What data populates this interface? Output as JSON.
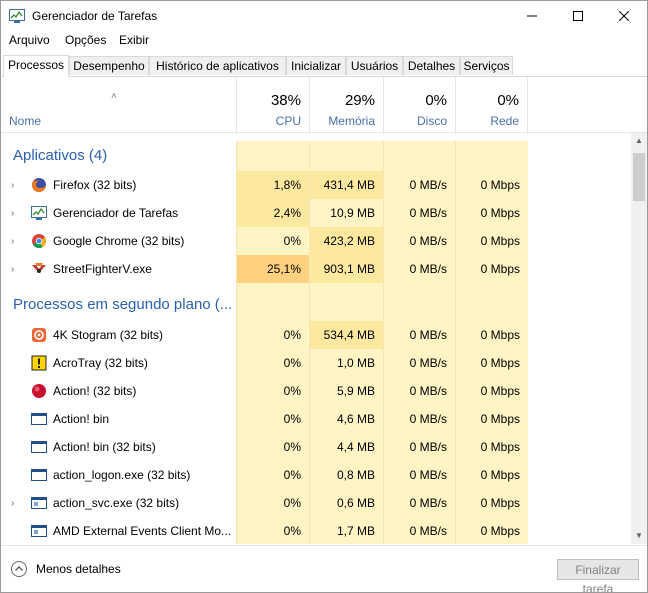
{
  "window": {
    "title": "Gerenciador de Tarefas"
  },
  "menu": [
    "Arquivo",
    "Opções",
    "Exibir"
  ],
  "tabs": [
    "Processos",
    "Desempenho",
    "Histórico de aplicativos",
    "Inicializar",
    "Usuários",
    "Detalhes",
    "Serviços"
  ],
  "header": {
    "name": "Nome",
    "cpu_pct": "38%",
    "cpu": "CPU",
    "mem_pct": "29%",
    "mem": "Memória",
    "disk_pct": "0%",
    "disk": "Disco",
    "net_pct": "0%",
    "net": "Rede"
  },
  "groups": {
    "apps": "Aplicativos (4)",
    "background": "Processos em segundo plano (..."
  },
  "apps": [
    {
      "name": "Firefox (32 bits)",
      "cpu": "1,8%",
      "mem": "431,4 MB",
      "disk": "0 MB/s",
      "net": "0 Mbps",
      "icon": "firefox-icon"
    },
    {
      "name": "Gerenciador de Tarefas",
      "cpu": "2,4%",
      "mem": "10,9 MB",
      "disk": "0 MB/s",
      "net": "0 Mbps",
      "icon": "task-manager-icon"
    },
    {
      "name": "Google Chrome (32 bits)",
      "cpu": "0%",
      "mem": "423,2 MB",
      "disk": "0 MB/s",
      "net": "0 Mbps",
      "icon": "chrome-icon"
    },
    {
      "name": "StreetFighterV.exe",
      "cpu": "25,1%",
      "mem": "903,1 MB",
      "disk": "0 MB/s",
      "net": "0 Mbps",
      "icon": "street-fighter-icon"
    }
  ],
  "background": [
    {
      "name": "4K Stogram (32 bits)",
      "cpu": "0%",
      "mem": "534,4 MB",
      "disk": "0 MB/s",
      "net": "0 Mbps",
      "icon": "stogram-icon"
    },
    {
      "name": "AcroTray (32 bits)",
      "cpu": "0%",
      "mem": "1,0 MB",
      "disk": "0 MB/s",
      "net": "0 Mbps",
      "icon": "acrotray-icon"
    },
    {
      "name": "Action! (32 bits)",
      "cpu": "0%",
      "mem": "5,9 MB",
      "disk": "0 MB/s",
      "net": "0 Mbps",
      "icon": "action-record-icon"
    },
    {
      "name": "Action! bin",
      "cpu": "0%",
      "mem": "4,6 MB",
      "disk": "0 MB/s",
      "net": "0 Mbps",
      "icon": "window-app-icon"
    },
    {
      "name": "Action! bin (32 bits)",
      "cpu": "0%",
      "mem": "4,4 MB",
      "disk": "0 MB/s",
      "net": "0 Mbps",
      "icon": "window-app-icon"
    },
    {
      "name": "action_logon.exe (32 bits)",
      "cpu": "0%",
      "mem": "0,8 MB",
      "disk": "0 MB/s",
      "net": "0 Mbps",
      "icon": "window-app-icon"
    },
    {
      "name": "action_svc.exe (32 bits)",
      "cpu": "0%",
      "mem": "0,6 MB",
      "disk": "0 MB/s",
      "net": "0 Mbps",
      "icon": "service-icon"
    },
    {
      "name": "AMD External Events Client Mo...",
      "cpu": "0%",
      "mem": "1,7 MB",
      "disk": "0 MB/s",
      "net": "0 Mbps",
      "icon": "service-icon"
    }
  ],
  "footer": {
    "less_details": "Menos detalhes",
    "end_task": "Finalizar tarefa"
  }
}
